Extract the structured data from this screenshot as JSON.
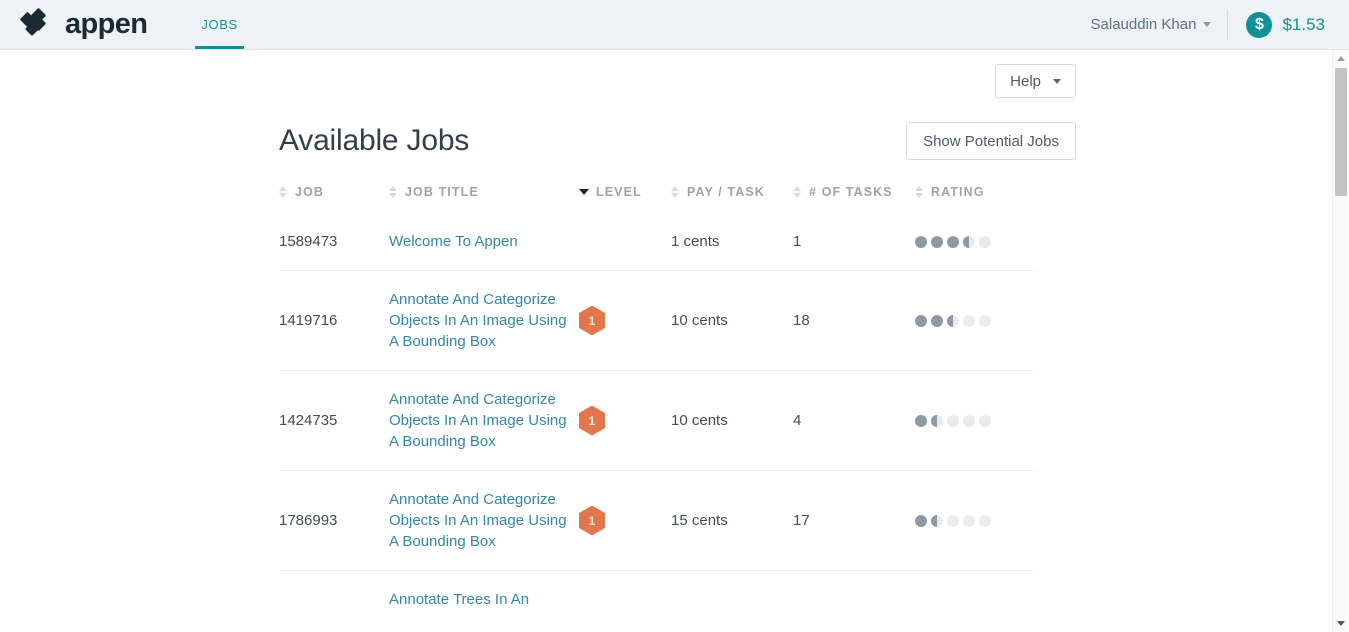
{
  "topbar": {
    "brand_name": "appen",
    "logo_icon": "appen-diamond-logo",
    "tabs": [
      {
        "label": "JOBS",
        "active": true
      }
    ],
    "user_name": "Salauddin Khan",
    "user_caret_icon": "chevron-down-icon",
    "balance_icon": "dollar-coin-icon",
    "balance_symbol": "$",
    "balance_amount": "$1.53"
  },
  "toolbar": {
    "help_label": "Help",
    "help_caret_icon": "chevron-down-icon"
  },
  "main": {
    "page_title": "Available Jobs",
    "show_potential_label": "Show Potential Jobs"
  },
  "table": {
    "columns": [
      {
        "label": "JOB",
        "sort": "none"
      },
      {
        "label": "JOB TITLE",
        "sort": "none"
      },
      {
        "label": "LEVEL",
        "sort": "desc"
      },
      {
        "label": "PAY / TASK",
        "sort": "none"
      },
      {
        "label": "# OF TASKS",
        "sort": "none"
      },
      {
        "label": "RATING",
        "sort": "none"
      }
    ],
    "rows": [
      {
        "job": "1589473",
        "title": "Welcome To Appen",
        "level": "",
        "pay": "1 cents",
        "tasks": "1",
        "rating": 3.5
      },
      {
        "job": "1419716",
        "title": "Annotate And Categorize Objects In An Image Using A Bounding Box",
        "level": "1",
        "pay": "10 cents",
        "tasks": "18",
        "rating": 2.5
      },
      {
        "job": "1424735",
        "title": "Annotate And Categorize Objects In An Image Using A Bounding Box",
        "level": "1",
        "pay": "10 cents",
        "tasks": "4",
        "rating": 1.5
      },
      {
        "job": "1786993",
        "title": "Annotate And Categorize Objects In An Image Using A Bounding Box",
        "level": "1",
        "pay": "15 cents",
        "tasks": "17",
        "rating": 1.5
      },
      {
        "job": "",
        "title": "Annotate Trees In An",
        "level": "",
        "pay": "",
        "tasks": "",
        "rating": 0
      }
    ],
    "rating_max": 5
  },
  "scrollbar": {
    "up_icon": "scroll-up-arrow-icon",
    "down_icon": "scroll-down-arrow-icon"
  },
  "colors": {
    "brand_teal": "#0e9298",
    "link_blue": "#3287a8",
    "level_orange": "#e2764c",
    "header_bg": "#eff2f4"
  }
}
